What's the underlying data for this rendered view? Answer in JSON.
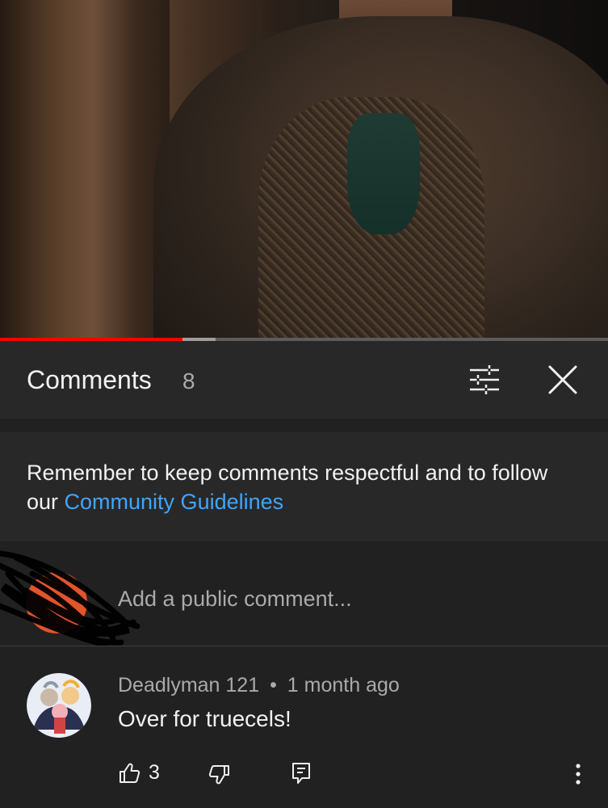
{
  "video": {
    "progress_played": 0.3,
    "progress_buffered": 0.355
  },
  "header": {
    "title": "Comments",
    "count": "8",
    "filter_icon": "sort-filter-icon",
    "close_icon": "close-icon"
  },
  "notice": {
    "text": "Remember to keep comments respectful and to follow our ",
    "link": "Community Guidelines"
  },
  "add_comment": {
    "placeholder": "Add a public comment..."
  },
  "comments": [
    {
      "author": "Deadlyman 121",
      "separator": "•",
      "time": "1 month ago",
      "text": "Over for truecels!",
      "likes": "3"
    }
  ],
  "colors": {
    "accent_link": "#3ea6ff",
    "progress_red": "#ff0000",
    "background": "#212121",
    "panel": "#282828"
  }
}
